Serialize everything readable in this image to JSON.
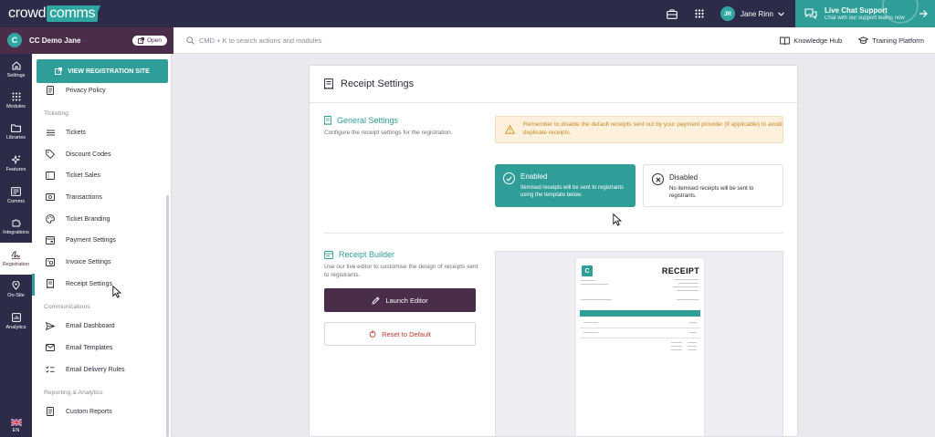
{
  "brand": {
    "word": "crowd",
    "tag": "comms"
  },
  "user": {
    "initials": "JR",
    "name": "Jane Rinn"
  },
  "live_chat": {
    "title": "Live Chat Support",
    "subtitle": "Chat with our support teams now"
  },
  "event": {
    "initial": "C",
    "name": "CC Demo Jane",
    "open_label": "Open"
  },
  "search": {
    "placeholder": "CMD + K to search actions and modules"
  },
  "links": {
    "knowledge_hub": "Knowledge Hub",
    "training_platform": "Training Platform"
  },
  "rail": {
    "items": [
      "Settings",
      "Modules",
      "Libraries",
      "Features",
      "Comms",
      "Integrations",
      "Registration",
      "On-Site",
      "Analytics"
    ],
    "lang": "EN"
  },
  "sidebar": {
    "view_registration_site": "VIEW REGISTRATION SITE",
    "privacy_policy": "Privacy Policy",
    "ticketing_head": "Ticketing",
    "ticketing": [
      "Tickets",
      "Discount Codes",
      "Ticket Sales",
      "Transactions",
      "Ticket Branding",
      "Payment Settings",
      "Invoice Settings",
      "Receipt Settings"
    ],
    "communications_head": "Communications",
    "communications": [
      "Email Dashboard",
      "Email Templates",
      "Email Delivery Rules"
    ],
    "reporting_head": "Reporting & Analytics",
    "reporting": [
      "Custom Reports"
    ]
  },
  "page": {
    "title": "Receipt Settings",
    "general": {
      "title": "General Settings",
      "desc": "Configure the receipt settings for the registration.",
      "warning": "Remember to disable the default receipts sent out by your payment provider (if applicable) to avoid duplicate receipts.",
      "enabled_title": "Enabled",
      "enabled_desc": "Itemised receipts will be sent to registrants using the template below.",
      "disabled_title": "Disabled",
      "disabled_desc": "No itemised receipts will be sent to registrants."
    },
    "builder": {
      "title": "Receipt Builder",
      "desc": "Use our live editor to customise the design of receipts sent to registrants.",
      "launch": "Launch Editor",
      "reset": "Reset to Default",
      "preview_title": "RECEIPT"
    }
  },
  "colors": {
    "nav": "#2c2c48",
    "teal": "#2f9e98",
    "plum": "#4a2d48",
    "warn_bg": "#fdf0dc",
    "warn_text": "#c58a23",
    "danger": "#c0392b"
  }
}
